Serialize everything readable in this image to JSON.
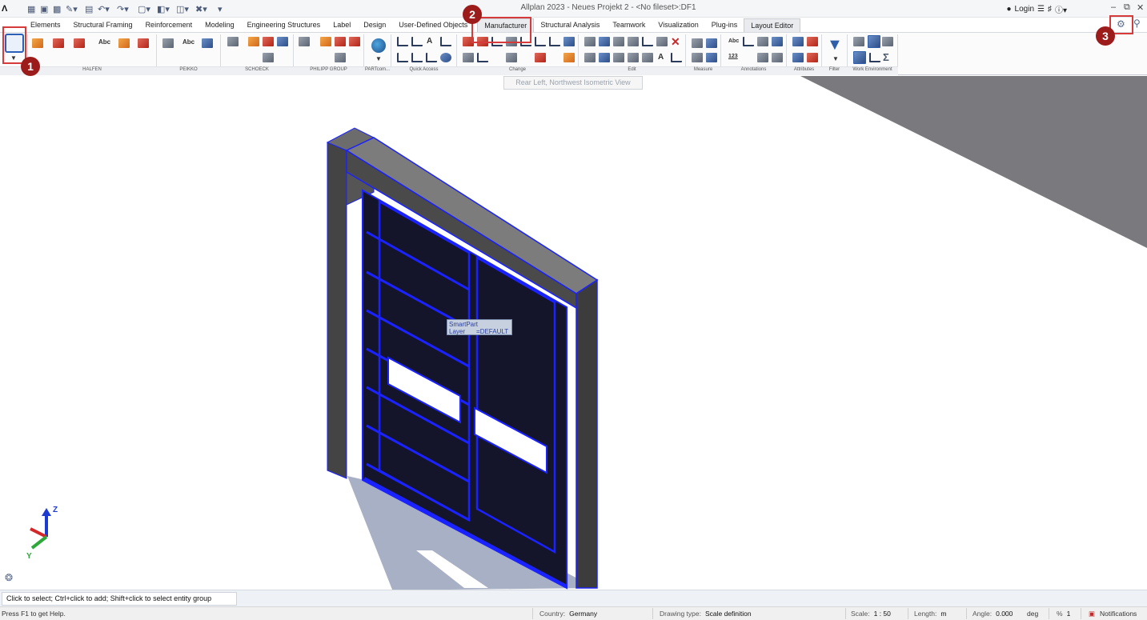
{
  "titlebar": {
    "app_logo": "Λ",
    "window_title": "Allplan 2023 - Neues Projekt 2 - <No fileset>:DF1",
    "login_label": "Login",
    "minimize": "–",
    "restore": "⧉",
    "close": "✕"
  },
  "tabs": [
    {
      "label": "Elements"
    },
    {
      "label": "Structural Framing"
    },
    {
      "label": "Reinforcement"
    },
    {
      "label": "Modeling"
    },
    {
      "label": "Engineering Structures"
    },
    {
      "label": "Label"
    },
    {
      "label": "Design"
    },
    {
      "label": "User-Defined Objects"
    },
    {
      "label": "Manufacturer"
    },
    {
      "label": "Structural Analysis"
    },
    {
      "label": "Teamwork"
    },
    {
      "label": "Visualization"
    },
    {
      "label": "Plug-ins"
    },
    {
      "label": "Layout Editor"
    }
  ],
  "ribbon_groups": [
    {
      "label": "HALFEN"
    },
    {
      "label": "PEIKKO"
    },
    {
      "label": "SCHOECK"
    },
    {
      "label": "PHILIPP GROUP"
    },
    {
      "label": "PARTcom..."
    },
    {
      "label": "Quick Access"
    },
    {
      "label": "Change"
    },
    {
      "label": "Edit"
    },
    {
      "label": "Measure"
    },
    {
      "label": "Annotations"
    },
    {
      "label": "Attributes"
    },
    {
      "label": "Filter"
    },
    {
      "label": "Work Environment"
    }
  ],
  "ribbon_text_icons": {
    "abc": "Abc",
    "n123": "123"
  },
  "view_tooltip": "Rear Left, Northwest Isometric View",
  "smartpart_tooltip": {
    "line1": "SmartPart",
    "layer_label": "Layer",
    "layer_value": "=DEFAULT"
  },
  "annotations": {
    "c1": "1",
    "c2": "2",
    "c3": "3"
  },
  "axis": {
    "z": "Z",
    "y": "Y"
  },
  "command_prompt": "Click to select; Ctrl+click to add; Shift+click to select entity group",
  "status": {
    "help": "Press F1 to get Help.",
    "country_label": "Country:",
    "country_value": "Germany",
    "drawing_type_label": "Drawing type:",
    "drawing_type_value": "Scale definition",
    "scale_label": "Scale:",
    "scale_value": "1 : 50",
    "length_label": "Length:",
    "length_value": "m",
    "angle_label": "Angle:",
    "angle_value": "0.000",
    "angle_unit": "deg",
    "percent_label": "%",
    "percent_value": "1",
    "notifications": "Notifications"
  },
  "colors": {
    "accent": "#1a22ff",
    "door_panel": "#14142a",
    "frame": "#3a3a3a",
    "callout": "#9c1b1b",
    "highlight": "#d63a3a"
  }
}
